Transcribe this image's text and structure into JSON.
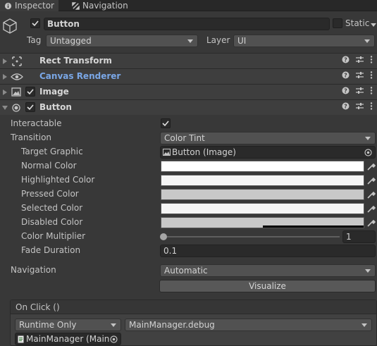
{
  "tabs": [
    {
      "label": "Inspector",
      "icon": "info-icon"
    },
    {
      "label": "Navigation",
      "icon": "navigation-icon"
    }
  ],
  "header": {
    "object_name": "Button",
    "static_label": "Static",
    "tag_label": "Tag",
    "tag_value": "Untagged",
    "layer_label": "Layer",
    "layer_value": "UI"
  },
  "components": [
    {
      "name": "Rect Transform",
      "icon": "rect-transform-icon"
    },
    {
      "name": "Canvas Renderer",
      "icon": "eye-icon"
    },
    {
      "name": "Image",
      "icon": "image-icon"
    },
    {
      "name": "Button",
      "icon": "button-icon"
    }
  ],
  "button_component": {
    "interactable_label": "Interactable",
    "transition_label": "Transition",
    "transition_value": "Color Tint",
    "target_graphic_label": "Target Graphic",
    "target_graphic_value": "Button (Image)",
    "normal_color_label": "Normal Color",
    "highlighted_color_label": "Highlighted Color",
    "pressed_color_label": "Pressed Color",
    "selected_color_label": "Selected Color",
    "disabled_color_label": "Disabled Color",
    "color_multiplier_label": "Color Multiplier",
    "color_multiplier_value": "1",
    "fade_duration_label": "Fade Duration",
    "fade_duration_value": "0.1",
    "navigation_label": "Navigation",
    "navigation_value": "Automatic",
    "visualize_label": "Visualize",
    "colors": {
      "normal": "#ffffff",
      "highlighted": "#f5f5f5",
      "pressed": "#c8c8c8",
      "selected": "#f5f5f5",
      "disabled": "#c8c8c8"
    }
  },
  "on_click": {
    "title": "On Click ()",
    "runtime_value": "Runtime Only",
    "function_value": "MainManager.debug",
    "object_value": "MainManager (Main"
  },
  "colors": {
    "background": "#383838",
    "accent_blue": "#7aa7e6"
  }
}
